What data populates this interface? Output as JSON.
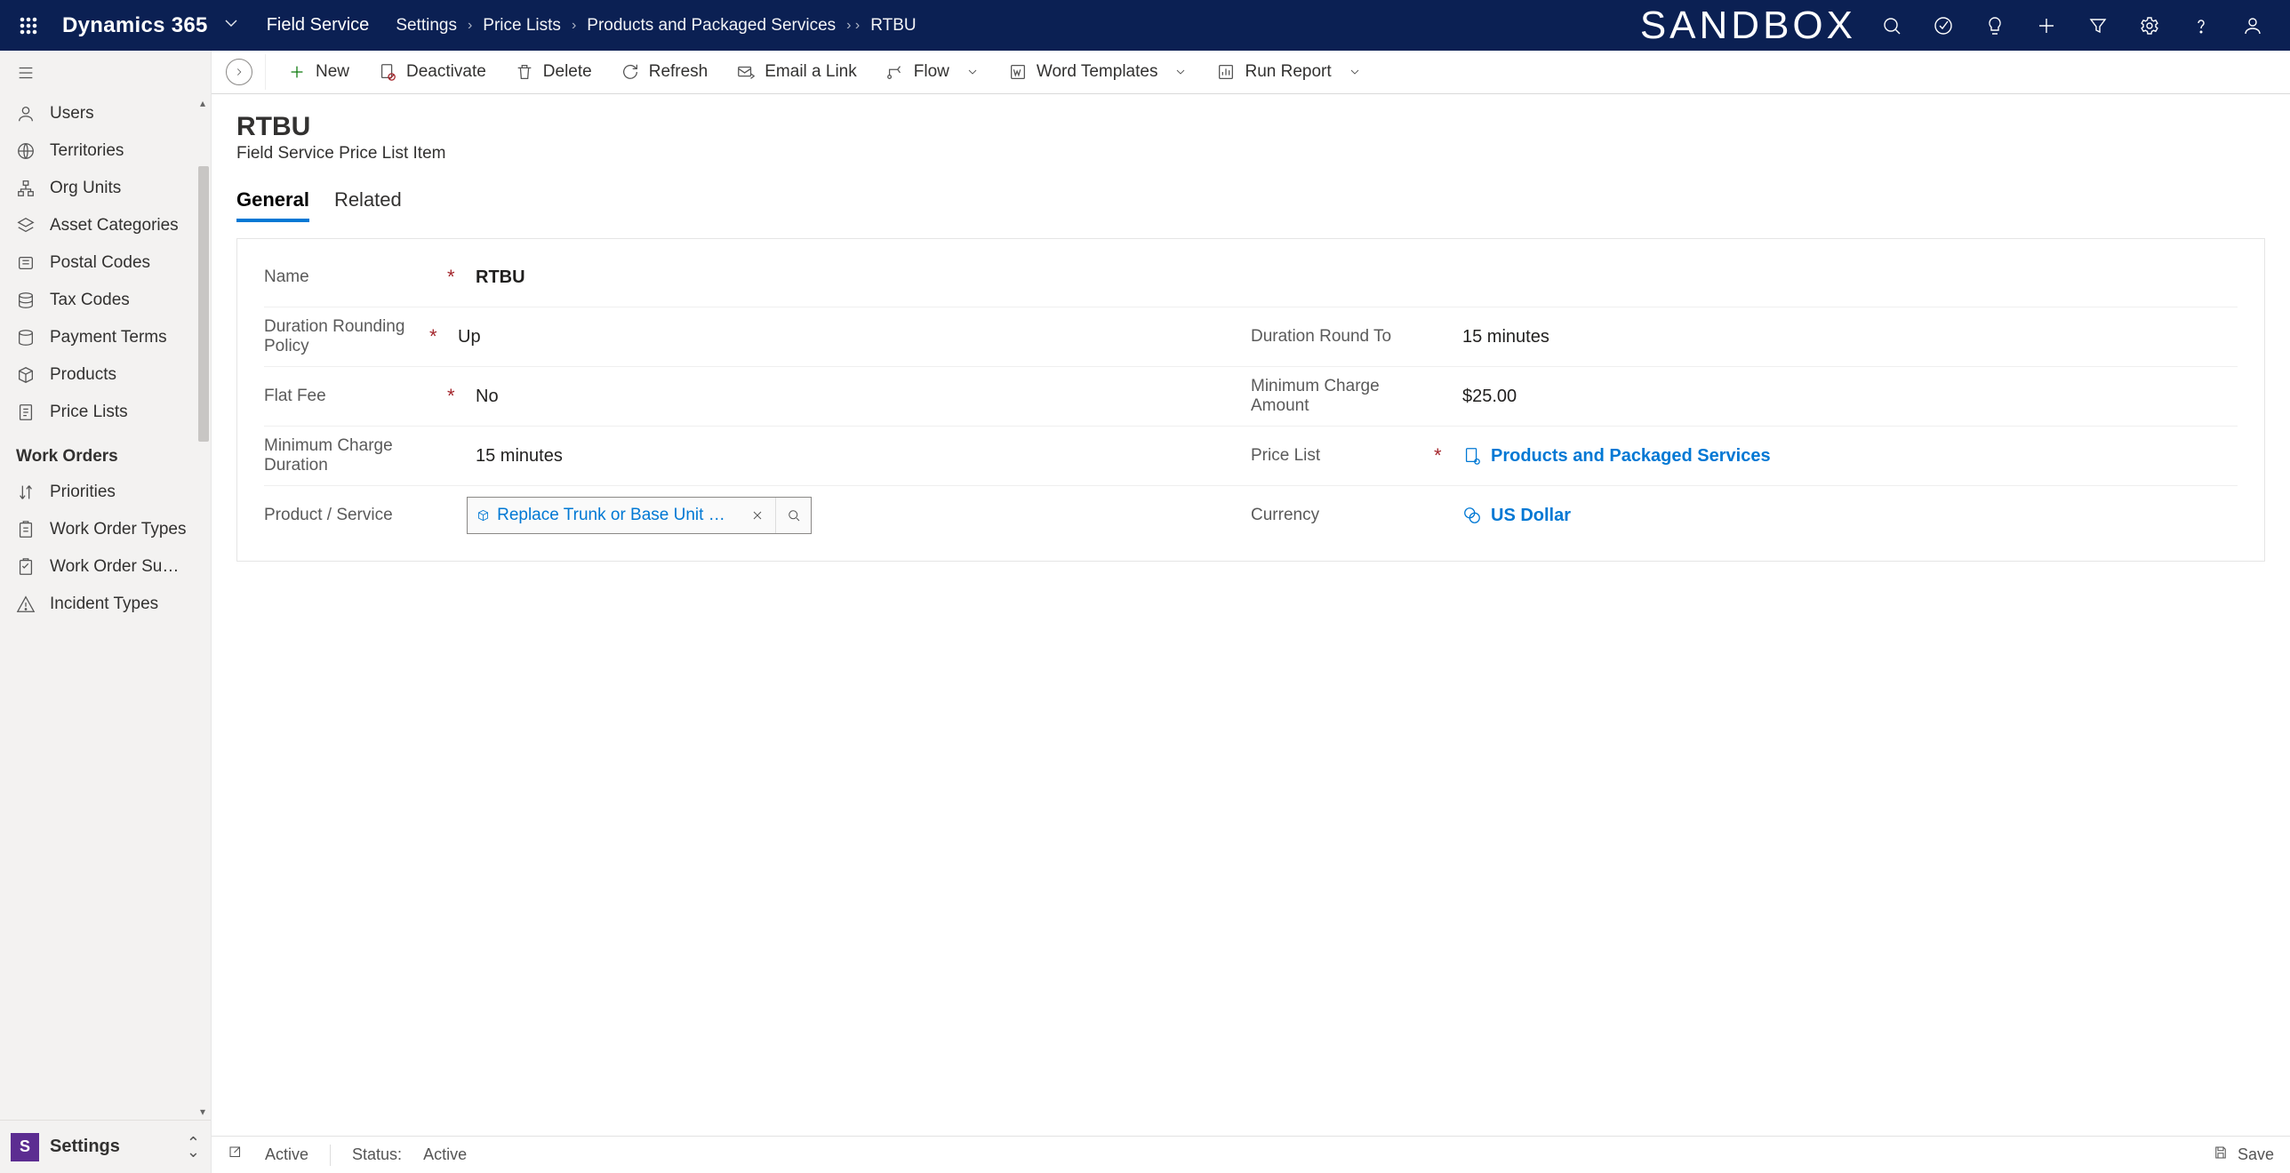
{
  "topbar": {
    "brand": "Dynamics 365",
    "app": "Field Service",
    "breadcrumb": [
      "Settings",
      "Price Lists",
      "Products and Packaged Services",
      "RTBU"
    ],
    "sandbox": "SANDBOX"
  },
  "sidebar": {
    "items": [
      {
        "icon": "user",
        "label": "Users"
      },
      {
        "icon": "globe",
        "label": "Territories"
      },
      {
        "icon": "org",
        "label": "Org Units"
      },
      {
        "icon": "asset",
        "label": "Asset Categories"
      },
      {
        "icon": "postal",
        "label": "Postal Codes"
      },
      {
        "icon": "tax",
        "label": "Tax Codes"
      },
      {
        "icon": "payment",
        "label": "Payment Terms"
      },
      {
        "icon": "product",
        "label": "Products"
      },
      {
        "icon": "pricelist",
        "label": "Price Lists"
      }
    ],
    "group": "Work Orders",
    "items2": [
      {
        "icon": "priority",
        "label": "Priorities"
      },
      {
        "icon": "wotype",
        "label": "Work Order Types"
      },
      {
        "icon": "wosub",
        "label": "Work Order Subst…"
      },
      {
        "icon": "incident",
        "label": "Incident Types"
      }
    ],
    "area": {
      "badge": "S",
      "label": "Settings"
    }
  },
  "commands": {
    "new": "New",
    "deactivate": "Deactivate",
    "delete": "Delete",
    "refresh": "Refresh",
    "email": "Email a Link",
    "flow": "Flow",
    "word": "Word Templates",
    "report": "Run Report"
  },
  "record": {
    "title": "RTBU",
    "subtitle": "Field Service Price List Item",
    "tabs": {
      "general": "General",
      "related": "Related"
    },
    "fields": {
      "name": {
        "label": "Name",
        "value": "RTBU",
        "required": true
      },
      "rounding": {
        "label": "Duration Rounding Policy",
        "value": "Up",
        "required": true
      },
      "roundto": {
        "label": "Duration Round To",
        "value": "15 minutes"
      },
      "flatfee": {
        "label": "Flat Fee",
        "value": "No",
        "required": true
      },
      "mincharge_amt": {
        "label": "Minimum Charge Amount",
        "value": "$25.00"
      },
      "mincharge_dur": {
        "label": "Minimum Charge Duration",
        "value": "15 minutes"
      },
      "pricelist": {
        "label": "Price List",
        "value": "Products and Packaged Services",
        "required": true
      },
      "product": {
        "label": "Product / Service",
        "value": "Replace Trunk or Base Unit (Flat H…"
      },
      "currency": {
        "label": "Currency",
        "value": "US Dollar"
      }
    }
  },
  "statusbar": {
    "state": "Active",
    "status_label": "Status:",
    "status_value": "Active",
    "save": "Save"
  }
}
